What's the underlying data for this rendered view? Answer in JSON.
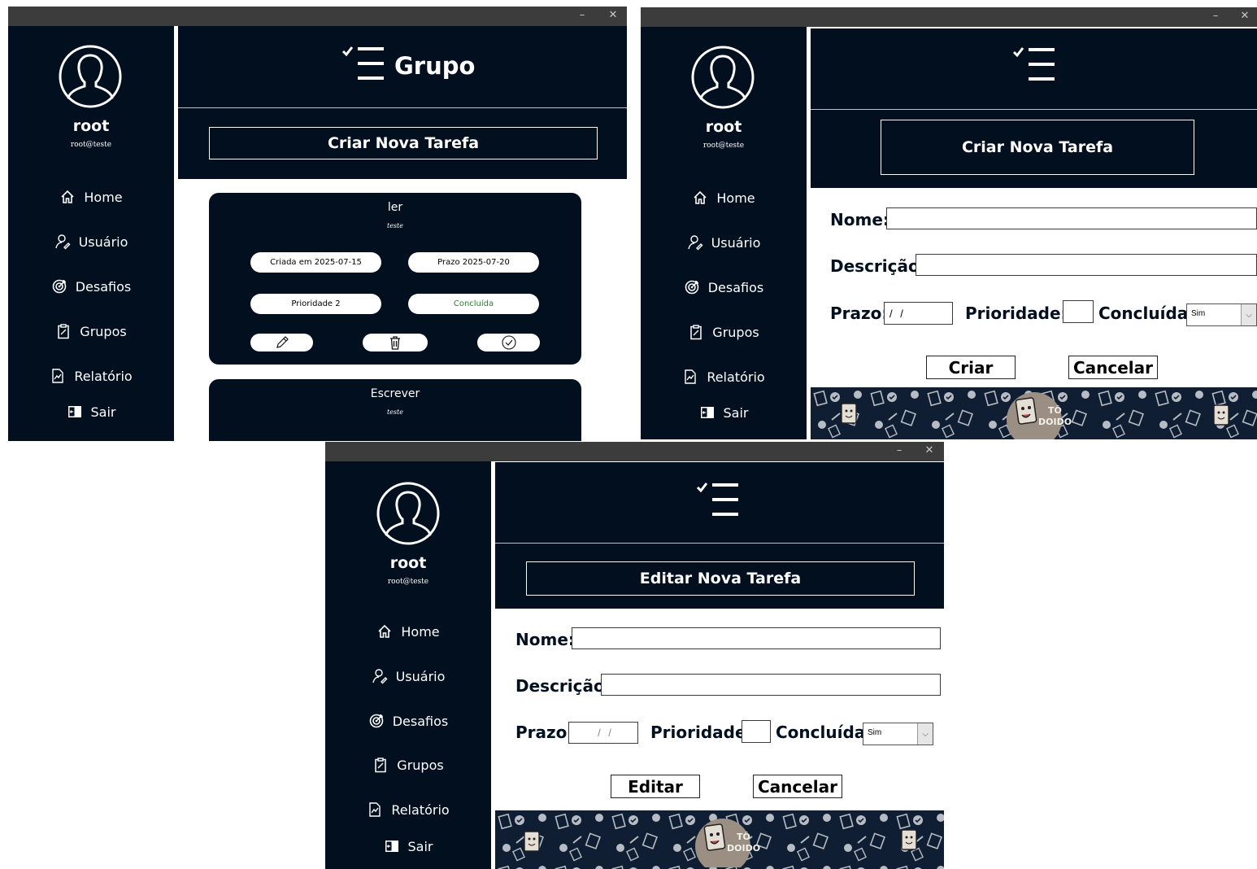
{
  "window_controls": {
    "minimize": "–",
    "close": "✕"
  },
  "user": {
    "name": "root",
    "email": "root@teste"
  },
  "nav": {
    "items": [
      {
        "label": "Home",
        "icon": "home-icon"
      },
      {
        "label": "Usuário",
        "icon": "user-icon"
      },
      {
        "label": "Desafios",
        "icon": "target-icon"
      },
      {
        "label": "Grupos",
        "icon": "clipboard-icon"
      },
      {
        "label": "Relatório",
        "icon": "chart-icon"
      },
      {
        "label": "Sair",
        "icon": "exit-icon"
      }
    ]
  },
  "group_window": {
    "header_title": "Grupo",
    "create_task_button": "Criar Nova Tarefa",
    "tasks": [
      {
        "title": "ler",
        "description": "teste",
        "created": "Criada em 2025-07-15",
        "deadline": "Prazo 2025-07-20",
        "priority": "Prioridade 2",
        "status": "Concluída"
      },
      {
        "title": "Escrever",
        "description": "teste"
      }
    ]
  },
  "create_window": {
    "form_title": "Criar Nova Tarefa",
    "labels": {
      "name": "Nome:",
      "description": "Descrição:",
      "deadline": "Prazo:",
      "priority": "Prioridade:",
      "done": "Concluída:"
    },
    "values": {
      "name": "",
      "description": "",
      "deadline": "/ /",
      "priority": "",
      "done": "Sim"
    },
    "buttons": {
      "submit": "Criar",
      "cancel": "Cancelar"
    }
  },
  "edit_window": {
    "form_title": "Editar Nova Tarefa",
    "labels": {
      "name": "Nome:",
      "description": "Descrição:",
      "deadline": "Prazo:",
      "priority": "Prioridade:",
      "done": "Concluída:"
    },
    "values": {
      "name": "",
      "description": "",
      "deadline": "/ /",
      "priority": "",
      "done": "Sim"
    },
    "buttons": {
      "submit": "Editar",
      "cancel": "Cancelar"
    }
  },
  "banner": {
    "brand_line1": "TÔ",
    "brand_line2": "DOIDO"
  },
  "colors": {
    "navy": "#010f1f",
    "titlebar": "#3c3c3c",
    "white": "#ffffff",
    "done_green": "#2e7d32"
  }
}
